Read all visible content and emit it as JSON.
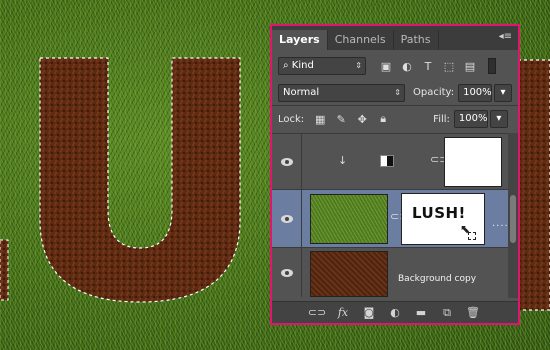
{
  "canvas": {
    "letters": [
      "U",
      "L"
    ],
    "texture_fill": "soil",
    "background_texture": "grass",
    "selection": "marching-ants"
  },
  "panel": {
    "tabs": [
      "Layers",
      "Channels",
      "Paths"
    ],
    "active_tab": "Layers",
    "menu_icon": "panel-menu-icon",
    "filter": {
      "kind_label": "Kind",
      "icons": [
        "image-filter-icon",
        "adjustment-filter-icon",
        "type-filter-icon",
        "shape-filter-icon",
        "smart-object-filter-icon"
      ]
    },
    "blend_mode": "Normal",
    "opacity_label": "Opacity:",
    "opacity_value": "100%",
    "lock_label": "Lock:",
    "lock_icons": [
      "lock-transparent-icon",
      "lock-image-icon",
      "lock-position-icon",
      "lock-all-icon"
    ],
    "fill_label": "Fill:",
    "fill_value": "100%",
    "layers": [
      {
        "name": "",
        "thumb": "adjustment-gradient",
        "mask": "white",
        "visible": true,
        "selected": false
      },
      {
        "name": "",
        "thumb": "grass",
        "mask": "text-mask",
        "mask_text": "LUSH!",
        "visible": true,
        "selected": true
      },
      {
        "name": "Background copy",
        "thumb": "soil",
        "visible": true,
        "selected": false
      }
    ],
    "bottom_icons": [
      "link-layers-icon",
      "fx-icon",
      "add-mask-icon",
      "adjustment-layer-icon",
      "group-folder-icon",
      "new-layer-icon",
      "trash-icon"
    ],
    "fx_label": "fx",
    "border_color": "#e0156f",
    "selected_row_color": "#6b7da1"
  }
}
